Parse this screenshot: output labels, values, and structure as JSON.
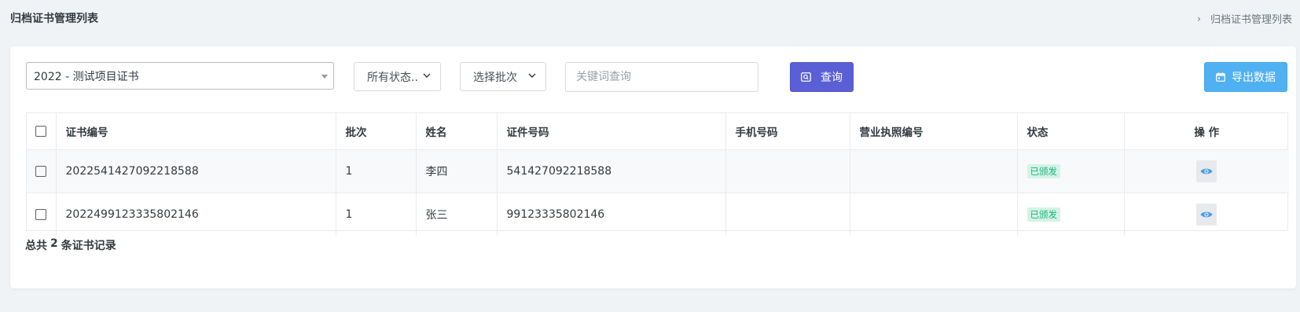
{
  "header": {
    "title": "归档证书管理列表",
    "breadcrumb_sep": "›",
    "breadcrumb_current": "归档证书管理列表"
  },
  "filters": {
    "project_selected": "2022 - 测试项目证书",
    "status_selected": "所有状态..",
    "batch_selected": "选择批次",
    "keyword_placeholder": "关键词查询",
    "keyword_value": ""
  },
  "buttons": {
    "query": "查询",
    "export": "导出数据"
  },
  "table": {
    "columns": [
      "证书编号",
      "批次",
      "姓名",
      "证件号码",
      "手机号码",
      "营业执照编号",
      "状态",
      "操 作"
    ],
    "rows": [
      {
        "cert_no": "2022541427092218588",
        "batch": "1",
        "name": "李四",
        "id_no": "541427092218588",
        "phone": "",
        "license_no": "",
        "status": "已颁发"
      },
      {
        "cert_no": "2022499123335802146",
        "batch": "1",
        "name": "张三",
        "id_no": "99123335802146",
        "phone": "",
        "license_no": "",
        "status": "已颁发"
      }
    ]
  },
  "footer": {
    "prefix": "总共",
    "count": "2",
    "suffix": "条证书记录"
  },
  "colors": {
    "query_button": "#5b5fd6",
    "export_button": "#4fb1f2",
    "status_badge_bg": "#d4f3e6",
    "status_badge_text": "#1ab77b",
    "view_icon": "#4a9de8"
  },
  "icons": {
    "query": "search-icon",
    "export": "calendar-icon",
    "action": "eye-icon",
    "dropdown": "chevron-down-icon"
  }
}
